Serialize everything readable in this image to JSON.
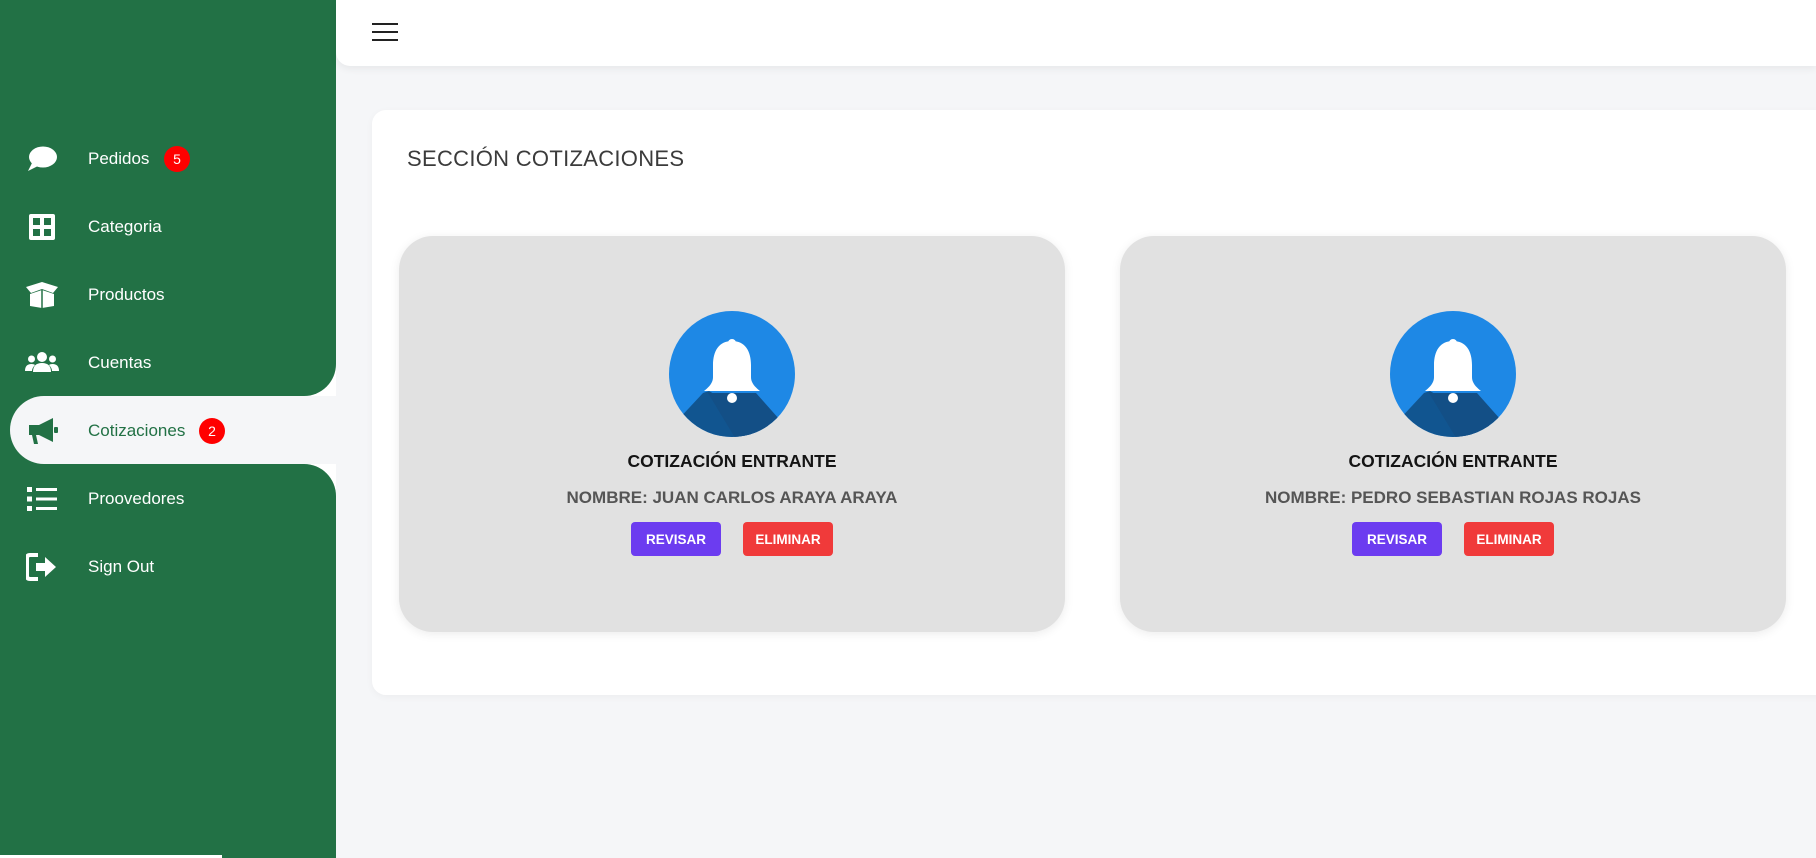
{
  "sidebar": {
    "items": [
      {
        "label": "Pedidos",
        "icon": "chat-bubble-icon",
        "badge": "5"
      },
      {
        "label": "Categoria",
        "icon": "grid-icon"
      },
      {
        "label": "Productos",
        "icon": "box-icon"
      },
      {
        "label": "Cuentas",
        "icon": "users-icon"
      },
      {
        "label": "Cotizaciones",
        "icon": "megaphone-icon",
        "badge": "2",
        "active": true
      },
      {
        "label": "Proovedores",
        "icon": "list-icon"
      },
      {
        "label": "Sign Out",
        "icon": "sign-out-icon"
      }
    ]
  },
  "main": {
    "title": "SECCIÓN COTIZACIONES",
    "cards": [
      {
        "title": "COTIZACIÓN ENTRANTE",
        "name": "NOMBRE: JUAN CARLOS ARAYA ARAYA",
        "review_label": "REVISAR",
        "delete_label": "ELIMINAR"
      },
      {
        "title": "COTIZACIÓN ENTRANTE",
        "name": "NOMBRE: PEDRO SEBASTIAN ROJAS ROJAS",
        "review_label": "REVISAR",
        "delete_label": "ELIMINAR"
      }
    ]
  },
  "colors": {
    "sidebar": "#227145",
    "badge": "#ff0000",
    "revisar": "#6c3cf0",
    "eliminar": "#f03a3a",
    "bell_circle": "#1e88e5"
  }
}
